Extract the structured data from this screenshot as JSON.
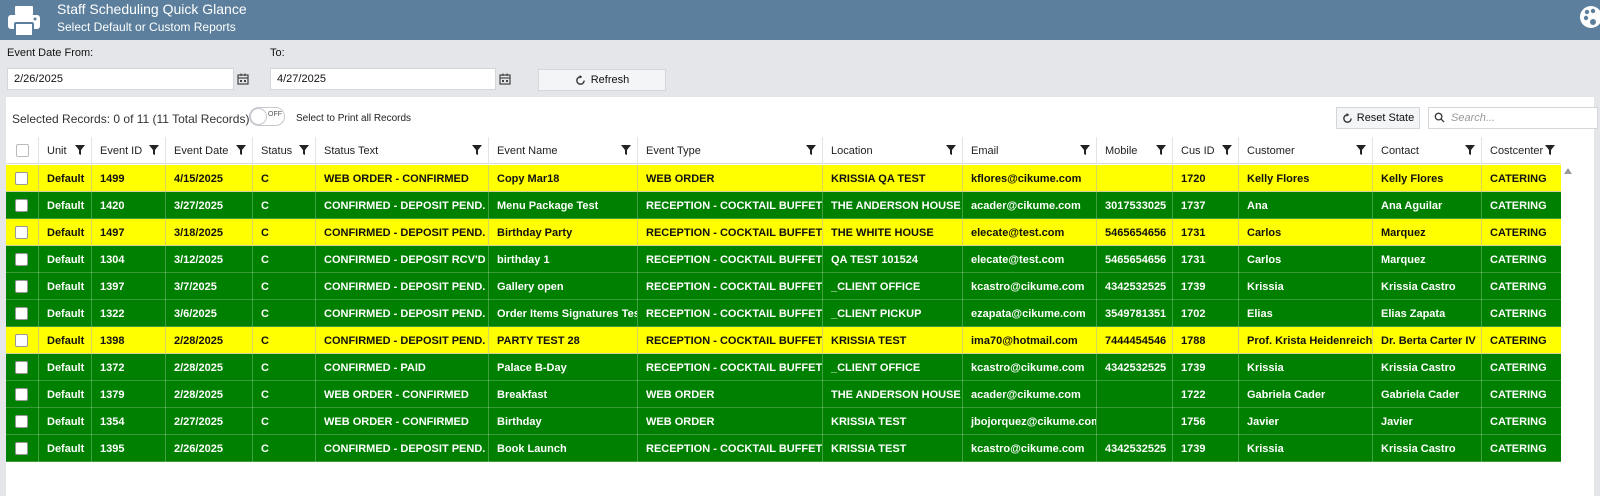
{
  "header": {
    "title": "Staff Scheduling Quick Glance",
    "subtitle": "Select Default or Custom Reports",
    "icons": {
      "left": "printer-icon",
      "right": "palette-icon"
    }
  },
  "filters": {
    "from_label": "Event Date From:",
    "from_value": "2/26/2025",
    "to_label": "To:",
    "to_value": "4/27/2025",
    "refresh_label": "Refresh"
  },
  "grid": {
    "selected_info": "Selected Records: 0 of 11 (11 Total Records)",
    "toggle_text": "OFF",
    "toggle_label": "Select to Print all Records",
    "reset_label": "Reset State",
    "search_placeholder": "Search...",
    "columns": [
      "Unit",
      "Event ID",
      "Event Date",
      "Status",
      "Status Text",
      "Event Name",
      "Event Type",
      "Location",
      "Email",
      "Mobile",
      "Cus ID",
      "Customer",
      "Contact",
      "Costcenter"
    ],
    "rows": [
      {
        "color": "yellow",
        "cells": [
          "Default",
          "1499",
          "4/15/2025",
          "C",
          "WEB ORDER - CONFIRMED",
          "Copy Mar18",
          "WEB ORDER",
          "KRISSIA QA TEST",
          "kflores@cikume.com",
          "",
          "1720",
          "Kelly Flores",
          "Kelly Flores",
          "CATERING"
        ]
      },
      {
        "color": "green",
        "cells": [
          "Default",
          "1420",
          "3/27/2025",
          "C",
          "CONFIRMED - DEPOSIT PEND.",
          "Menu Package Test",
          "RECEPTION - COCKTAIL BUFFET",
          "THE ANDERSON HOUSE",
          "acader@cikume.com",
          "3017533025",
          "1737",
          "Ana",
          "Ana Aguilar",
          "CATERING"
        ]
      },
      {
        "color": "yellow",
        "cells": [
          "Default",
          "1497",
          "3/18/2025",
          "C",
          "CONFIRMED - DEPOSIT PEND.",
          "Birthday Party",
          "RECEPTION - COCKTAIL BUFFET",
          "THE WHITE HOUSE",
          "elecate@test.com",
          "5465654656",
          "1731",
          "Carlos",
          "Marquez",
          "CATERING"
        ]
      },
      {
        "color": "green",
        "cells": [
          "Default",
          "1304",
          "3/12/2025",
          "C",
          "CONFIRMED - DEPOSIT RCV'D",
          "birthday 1",
          "RECEPTION - COCKTAIL BUFFET",
          "QA TEST 101524",
          "elecate@test.com",
          "5465654656",
          "1731",
          "Carlos",
          "Marquez",
          "CATERING"
        ]
      },
      {
        "color": "green",
        "cells": [
          "Default",
          "1397",
          "3/7/2025",
          "C",
          "CONFIRMED - DEPOSIT PEND.",
          "Gallery open",
          "RECEPTION - COCKTAIL BUFFET",
          "_CLIENT OFFICE",
          "kcastro@cikume.com",
          "4342532525",
          "1739",
          "Krissia",
          "Krissia Castro",
          "CATERING"
        ]
      },
      {
        "color": "green",
        "cells": [
          "Default",
          "1322",
          "3/6/2025",
          "C",
          "CONFIRMED - DEPOSIT PEND.",
          "Order Items Signatures Test",
          "RECEPTION - COCKTAIL BUFFET",
          "_CLIENT PICKUP",
          "ezapata@cikume.com",
          "3549781351",
          "1702",
          "Elias",
          "Elias Zapata",
          "CATERING"
        ]
      },
      {
        "color": "yellow",
        "cells": [
          "Default",
          "1398",
          "2/28/2025",
          "C",
          "CONFIRMED - DEPOSIT PEND.",
          "PARTY TEST 28",
          "RECEPTION - COCKTAIL BUFFET",
          "KRISSIA TEST",
          "ima70@hotmail.com",
          "7444454546",
          "1788",
          "Prof. Krista Heidenreich II",
          "Dr. Berta Carter IV",
          "CATERING"
        ]
      },
      {
        "color": "green",
        "cells": [
          "Default",
          "1372",
          "2/28/2025",
          "C",
          "CONFIRMED - PAID",
          "Palace B-Day",
          "RECEPTION - COCKTAIL BUFFET",
          "_CLIENT OFFICE",
          "kcastro@cikume.com",
          "4342532525",
          "1739",
          "Krissia",
          "Krissia Castro",
          "CATERING"
        ]
      },
      {
        "color": "green",
        "cells": [
          "Default",
          "1379",
          "2/28/2025",
          "C",
          "WEB ORDER - CONFIRMED",
          "Breakfast",
          "WEB ORDER",
          "THE ANDERSON HOUSE",
          "acader@cikume.com",
          "",
          "1722",
          "Gabriela Cader",
          "Gabriela Cader",
          "CATERING"
        ]
      },
      {
        "color": "green",
        "cells": [
          "Default",
          "1354",
          "2/27/2025",
          "C",
          "WEB ORDER - CONFIRMED",
          "Birthday",
          "WEB ORDER",
          "KRISSIA TEST",
          "jbojorquez@cikume.com",
          "",
          "1756",
          "Javier",
          "Javier",
          "CATERING"
        ]
      },
      {
        "color": "green",
        "cells": [
          "Default",
          "1395",
          "2/26/2025",
          "C",
          "CONFIRMED - DEPOSIT PEND.",
          "Book Launch",
          "RECEPTION - COCKTAIL BUFFET",
          "KRISSIA TEST",
          "kcastro@cikume.com",
          "4342532525",
          "1739",
          "Krissia",
          "Krissia Castro",
          "CATERING"
        ]
      }
    ]
  }
}
